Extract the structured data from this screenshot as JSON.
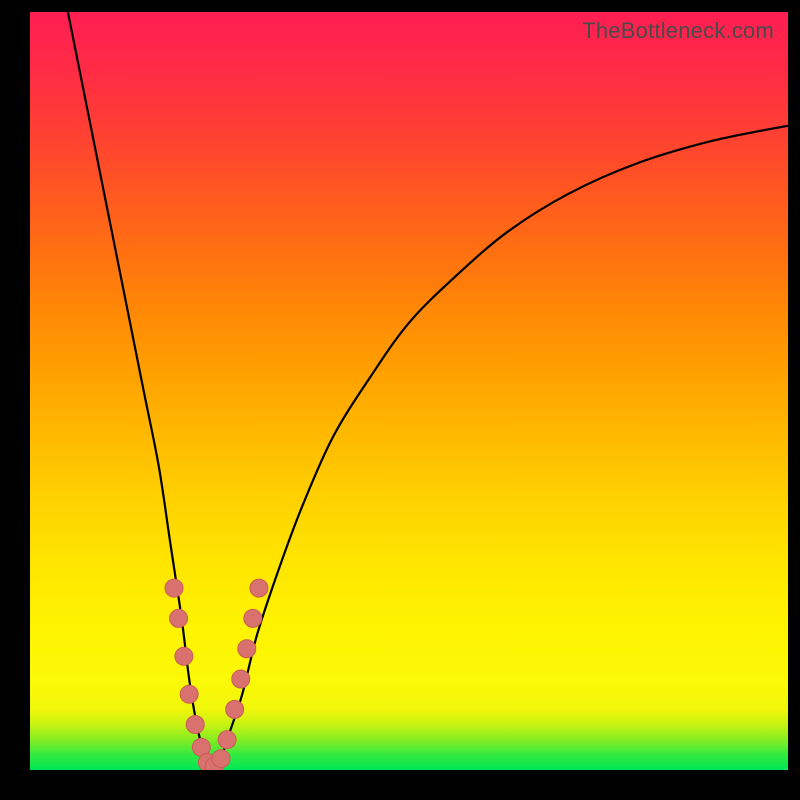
{
  "watermark": "TheBottleneck.com",
  "colors": {
    "background": "#000000",
    "curve": "#000000",
    "dots": "#d9716e",
    "dots_stroke": "#cc5c58"
  },
  "chart_data": {
    "type": "line",
    "title": "",
    "xlabel": "",
    "ylabel": "",
    "xlim": [
      0,
      100
    ],
    "ylim": [
      0,
      100
    ],
    "series": [
      {
        "name": "bottleneck-curve",
        "x": [
          5,
          7,
          9,
          11,
          13,
          15,
          17,
          18.5,
          20,
          21,
          22,
          23,
          24,
          25,
          26,
          28,
          30,
          33,
          36,
          40,
          45,
          50,
          56,
          63,
          71,
          80,
          90,
          100
        ],
        "y": [
          100,
          90,
          80,
          70,
          60,
          50,
          40,
          30,
          20,
          12,
          6,
          2,
          0,
          1,
          4,
          10,
          18,
          27,
          35,
          44,
          52,
          59,
          65,
          71,
          76,
          80,
          83,
          85
        ]
      }
    ],
    "sample_points": [
      {
        "x": 19.0,
        "y": 24
      },
      {
        "x": 19.6,
        "y": 20
      },
      {
        "x": 20.3,
        "y": 15
      },
      {
        "x": 21.0,
        "y": 10
      },
      {
        "x": 21.8,
        "y": 6
      },
      {
        "x": 22.6,
        "y": 3
      },
      {
        "x": 23.4,
        "y": 1
      },
      {
        "x": 24.3,
        "y": 0.5
      },
      {
        "x": 25.2,
        "y": 1.5
      },
      {
        "x": 26.0,
        "y": 4
      },
      {
        "x": 27.0,
        "y": 8
      },
      {
        "x": 27.8,
        "y": 12
      },
      {
        "x": 28.6,
        "y": 16
      },
      {
        "x": 29.4,
        "y": 20
      },
      {
        "x": 30.2,
        "y": 24
      }
    ]
  }
}
